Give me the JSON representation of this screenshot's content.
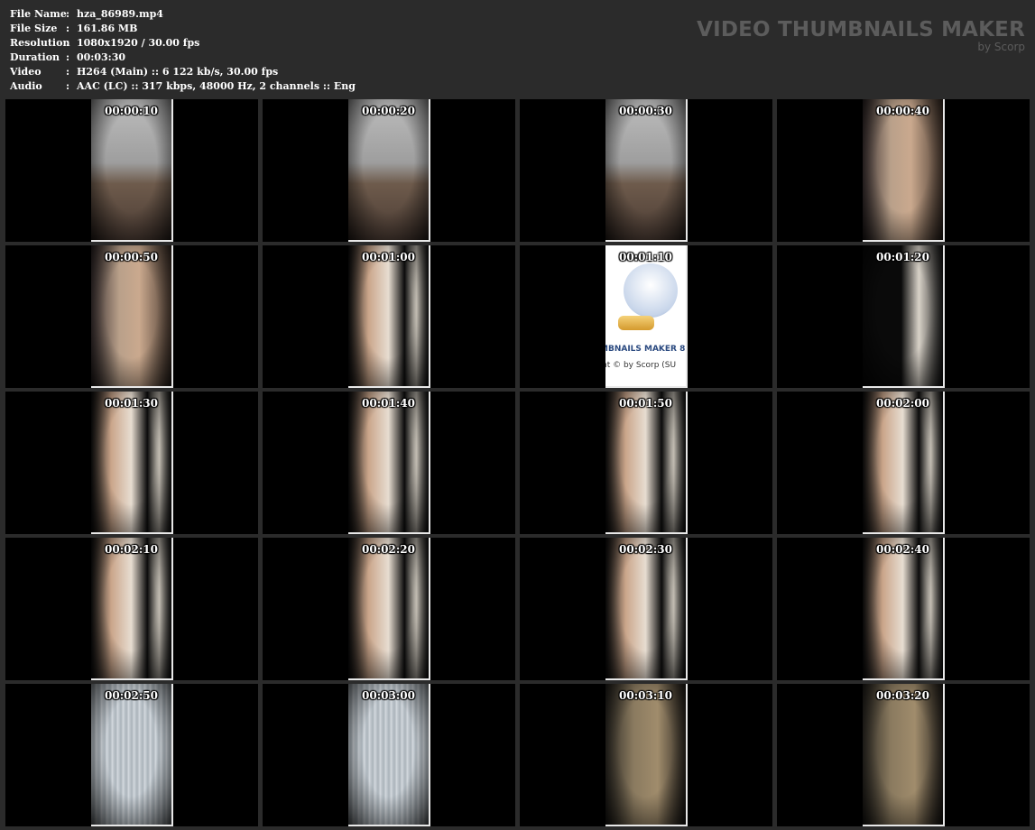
{
  "info": [
    {
      "key": "File Name",
      "value": "hza_86989.mp4"
    },
    {
      "key": "File Size",
      "value": "161.86 MB"
    },
    {
      "key": "Resolution",
      "value": "1080x1920 / 30.00 fps"
    },
    {
      "key": "Duration",
      "value": "00:03:30"
    },
    {
      "key": "Video",
      "value": "H264 (Main) :: 6 122 kb/s, 30.00 fps"
    },
    {
      "key": "Audio",
      "value": "AAC (LC) :: 317 kbps, 48000 Hz, 2 channels :: Eng"
    }
  ],
  "separator": ":",
  "brand": {
    "title": "VIDEO THUMBNAILS MAKER",
    "subtitle": "by Scorp"
  },
  "thumbnails": [
    {
      "time": "00:00:10",
      "scene": "shirt"
    },
    {
      "time": "00:00:20",
      "scene": "shirt"
    },
    {
      "time": "00:00:30",
      "scene": "shirt"
    },
    {
      "time": "00:00:40",
      "scene": "skin"
    },
    {
      "time": "00:00:50",
      "scene": "skin"
    },
    {
      "time": "00:01:00",
      "scene": "person"
    },
    {
      "time": "00:01:10",
      "scene": "logo"
    },
    {
      "time": "00:01:20",
      "scene": "wall"
    },
    {
      "time": "00:01:30",
      "scene": "person"
    },
    {
      "time": "00:01:40",
      "scene": "person"
    },
    {
      "time": "00:01:50",
      "scene": "person"
    },
    {
      "time": "00:02:00",
      "scene": "person"
    },
    {
      "time": "00:02:10",
      "scene": "person"
    },
    {
      "time": "00:02:20",
      "scene": "person"
    },
    {
      "time": "00:02:30",
      "scene": "person"
    },
    {
      "time": "00:02:40",
      "scene": "person"
    },
    {
      "time": "00:02:50",
      "scene": "curtain"
    },
    {
      "time": "00:03:00",
      "scene": "curtain"
    },
    {
      "time": "00:03:10",
      "scene": "door"
    },
    {
      "time": "00:03:20",
      "scene": "door"
    }
  ],
  "logo_frame": {
    "line1": "MBNAILS MAKER 8",
    "line2": "nt © by Scorp (SU"
  }
}
